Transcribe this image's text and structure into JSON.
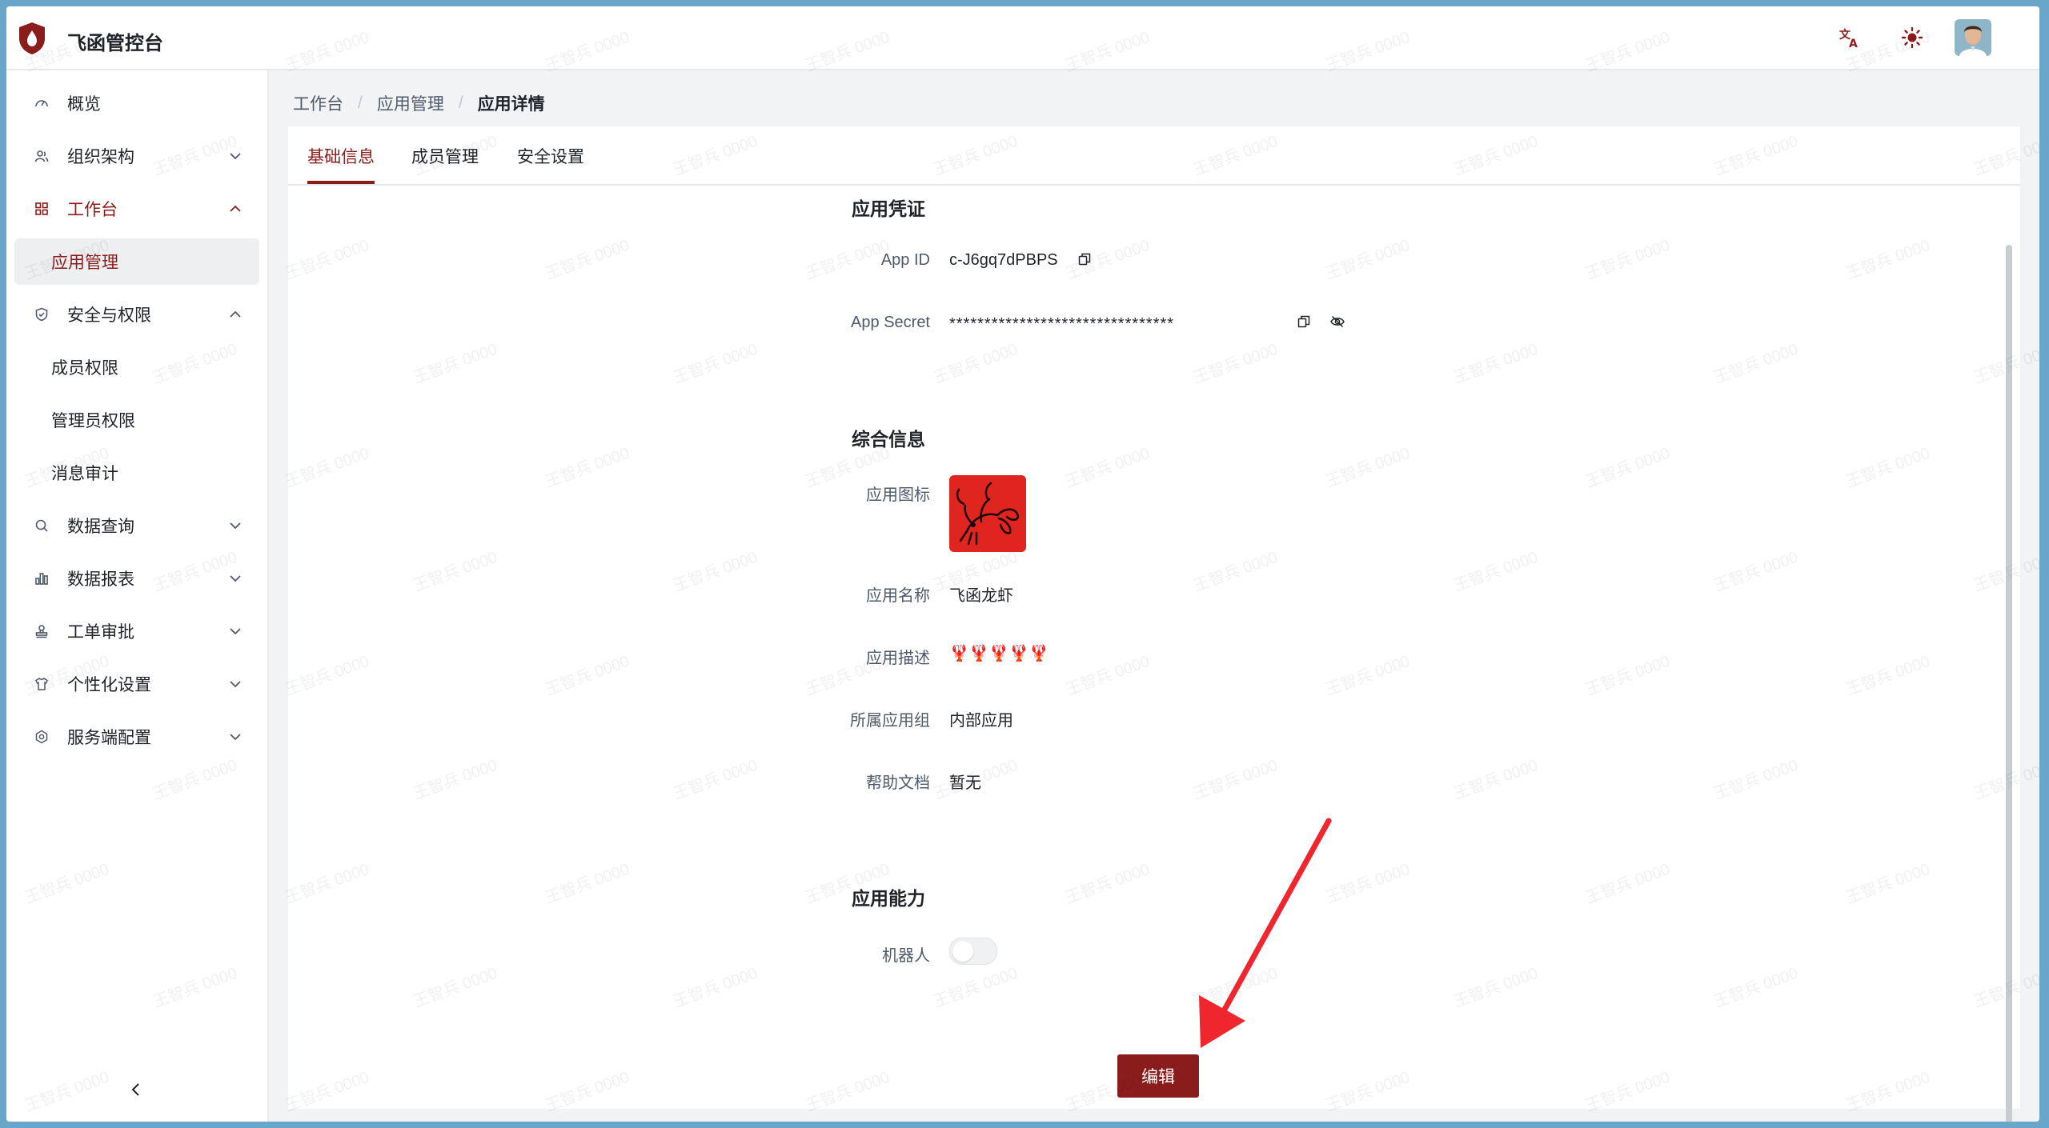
{
  "header": {
    "title": "飞函管控台",
    "icons": {
      "translate": "translate-icon",
      "theme": "sun-icon",
      "avatar": "user-avatar"
    }
  },
  "colors": {
    "brand": "#8b1c1c",
    "app_icon_bg": "#e02420"
  },
  "sidebar": {
    "items": [
      {
        "label": "概览",
        "icon": "dashboard-icon"
      },
      {
        "label": "组织架构",
        "icon": "org-icon",
        "expanded": false
      },
      {
        "label": "工作台",
        "icon": "grid-icon",
        "expanded": true,
        "active": true
      },
      {
        "label": "应用管理",
        "sub": true,
        "selected": true
      },
      {
        "label": "安全与权限",
        "icon": "shield-icon",
        "expanded": true
      },
      {
        "label": "成员权限",
        "sub": true
      },
      {
        "label": "管理员权限",
        "sub": true
      },
      {
        "label": "消息审计",
        "sub": true
      },
      {
        "label": "数据查询",
        "icon": "search-icon",
        "expanded": false
      },
      {
        "label": "数据报表",
        "icon": "bar-chart-icon",
        "expanded": false
      },
      {
        "label": "工单审批",
        "icon": "stamp-icon",
        "expanded": false
      },
      {
        "label": "个性化设置",
        "icon": "shirt-icon",
        "expanded": false
      },
      {
        "label": "服务端配置",
        "icon": "gear-icon",
        "expanded": false
      }
    ]
  },
  "breadcrumb": [
    "工作台",
    "应用管理",
    "应用详情"
  ],
  "tabs": [
    {
      "label": "基础信息",
      "active": true
    },
    {
      "label": "成员管理",
      "active": false
    },
    {
      "label": "安全设置",
      "active": false
    }
  ],
  "credentials": {
    "title": "应用凭证",
    "app_id_label": "App ID",
    "app_id_value": "c-J6gq7dPBPS",
    "app_secret_label": "App Secret",
    "app_secret_value": "********************************"
  },
  "general": {
    "title": "综合信息",
    "icon_label": "应用图标",
    "name_label": "应用名称",
    "name_value": "飞函龙虾",
    "desc_label": "应用描述",
    "desc_value": "🦞🦞🦞🦞🦞",
    "group_label": "所属应用组",
    "group_value": "内部应用",
    "help_label": "帮助文档",
    "help_value": "暂无"
  },
  "capabilities": {
    "title": "应用能力",
    "bot_label": "机器人",
    "bot_enabled": false
  },
  "actions": {
    "edit_label": "编辑"
  },
  "watermark": "王智兵 0000"
}
